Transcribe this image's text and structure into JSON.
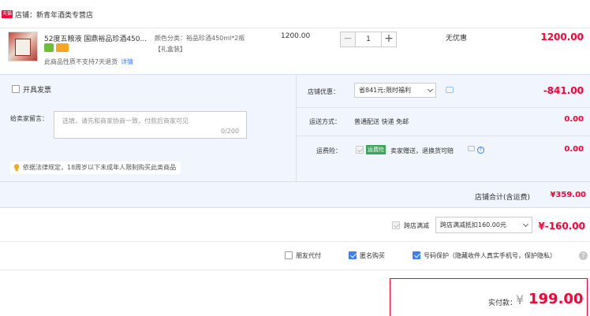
{
  "store": {
    "icon_label": "天猫",
    "name": "店铺：新青年酒类专营店"
  },
  "item": {
    "title": "52度五粮液 国鼎裕品珍酒450...",
    "no_return": "此商品性质不支持7天退货",
    "detail_link": "详情",
    "spec_line1": "颜色分类：裕品珍酒450ml*2瓶",
    "spec_line2": "【礼盒装】",
    "unit_price": "1200.00",
    "qty_minus": "−",
    "qty": "1",
    "qty_plus": "+",
    "discount": "无优惠",
    "line_total": "1200.00"
  },
  "options": {
    "invoice_label": "开具发票",
    "message_label": "给卖家留言：",
    "message_placeholder": "选填，请先和商家协商一致，付款后商家可见",
    "message_count": "0/200",
    "legal_notice": "依据法律规定，18周岁以下未成年人限制购买此类商品"
  },
  "discounts": {
    "shop_discount_label": "店铺优惠：",
    "shop_discount_select": "省841元:限时福利",
    "shop_discount_amount": "-841.00",
    "shipping_label": "运送方式：",
    "shipping_value": "普通配送 快递 免邮",
    "shipping_amount": "0.00",
    "insurance_label": "运费险：",
    "insurance_tag": "运费险",
    "insurance_text": "卖家赠送，退换货可赔",
    "insurance_help": "?",
    "insurance_amount": "0.00"
  },
  "subtotal": {
    "label": "店铺合计(含运费)",
    "amount": "¥359.00"
  },
  "cross_store": {
    "label": "跨店满减",
    "select": "跨店满减抵扣160.00元",
    "amount": "¥-160.00"
  },
  "checkout_options": [
    {
      "label": "朋友代付",
      "checked": false
    },
    {
      "label": "匿名购买",
      "checked": true
    },
    {
      "label": "号码保护（隐藏收件人真实手机号，保护隐私）",
      "checked": true
    }
  ],
  "help_icon": "?",
  "payment": {
    "label": "实付款：",
    "currency": "¥",
    "amount": "199.00"
  },
  "colors": {
    "accent_red": "#ff0036",
    "panel_blue": "#f1f5fd",
    "link_blue": "#3d7eff",
    "insurance_green": "#3aa65a"
  }
}
